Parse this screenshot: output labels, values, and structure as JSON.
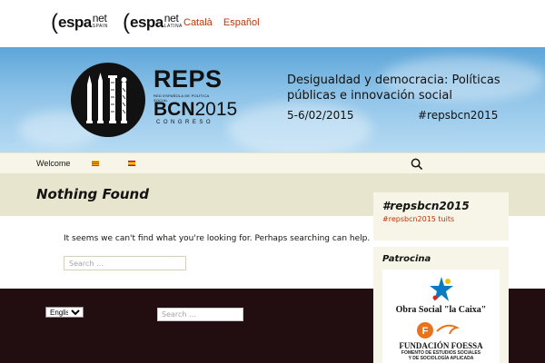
{
  "topbar": {
    "logos": [
      {
        "word": "espa",
        "net": "net",
        "tag": "SPAIN"
      },
      {
        "word": "espa",
        "net": "net",
        "tag": "LATINA"
      }
    ],
    "languages": [
      "Català",
      "Español"
    ]
  },
  "banner": {
    "title": "REPS",
    "subtitle": "RED ESPAÑOLA DE POLÍTICA SOCIAL",
    "event_bold": "BCN",
    "event_year": "2015",
    "event_label": "CONGRESO",
    "heading": "Desigualdad y democracia: Políticas públicas e innovación social",
    "dates": "5-6/02/2015",
    "hashtag": "#repsbcn2015"
  },
  "nav": {
    "welcome": "Welcome",
    "flag_cat": "catalan-flag-icon",
    "flag_esp": "spanish-flag-icon",
    "search_icon": "search-icon"
  },
  "main": {
    "title": "Nothing Found",
    "message": "It seems we can't find what you're looking for. Perhaps searching can help.",
    "search_placeholder": "Search …"
  },
  "footer": {
    "language_selected": "English",
    "search_placeholder": "Search …"
  },
  "sidebar": {
    "hashtag_title": "#repsbcn2015",
    "hashtag_link": "#repsbcn2015 tuits",
    "sponsor_title": "Patrocina",
    "sponsor1": "Obra Social \"la Caixa\"",
    "sponsor2_name": "FUNDACIÓN FOESSA",
    "sponsor2_sub1": "FOMENTO DE ESTUDIOS SOCIALES",
    "sponsor2_sub2": "Y DE SOCIOLOGÍA APLICADA"
  },
  "colors": {
    "accent": "#bc360a",
    "footer_bg": "#220e10",
    "nav_bg": "#f7f5e7",
    "title_band_bg": "#e8e5ce"
  }
}
